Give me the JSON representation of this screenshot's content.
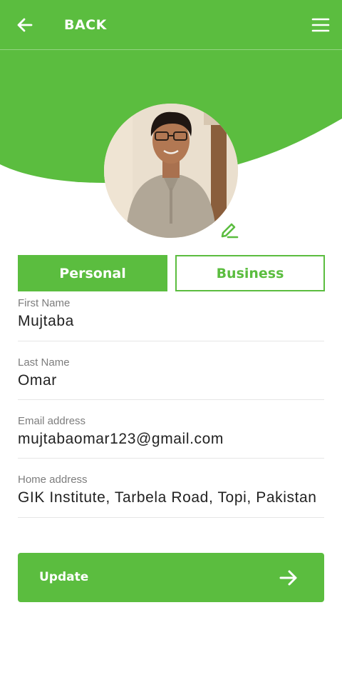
{
  "colors": {
    "accent": "#5bbd3f",
    "text": "#222222",
    "label": "#7d7d7d"
  },
  "topbar": {
    "back_icon": "arrow-left-icon",
    "back_label": "BACK",
    "menu_icon": "hamburger-menu-icon"
  },
  "profile": {
    "avatar": "profile-photo",
    "edit_icon": "pencil-edit-icon"
  },
  "tabs": [
    {
      "label": "Personal",
      "active": true
    },
    {
      "label": "Business",
      "active": false
    }
  ],
  "fields": [
    {
      "label": "First Name",
      "value": "Mujtaba"
    },
    {
      "label": "Last Name",
      "value": "Omar"
    },
    {
      "label": "Email address",
      "value": "mujtabaomar123@gmail.com"
    },
    {
      "label": "Home address",
      "value": "GIK Institute, Tarbela Road, Topi, Pakistan"
    }
  ],
  "update_button": {
    "label": "Update",
    "icon": "arrow-right-icon"
  }
}
